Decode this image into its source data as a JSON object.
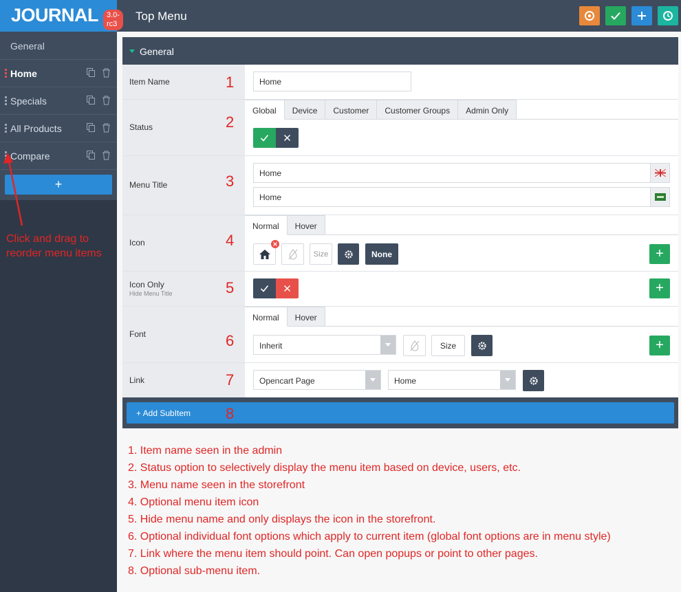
{
  "header": {
    "logo": "JOURNAL",
    "version": "3.0-rc3",
    "title": "Top Menu",
    "colors": {
      "bar": "#3e4c5e",
      "logo_bg": "#2b8bd6",
      "orange": "#e8883a",
      "green": "#27a860",
      "blue": "#2b8bd6",
      "teal": "#1bb5a0"
    }
  },
  "sidebar": {
    "general": "General",
    "items": [
      {
        "label": "Home"
      },
      {
        "label": "Specials"
      },
      {
        "label": "All Products"
      },
      {
        "label": "Compare"
      }
    ],
    "add": "+"
  },
  "side_note": "Click and drag to reorder menu items",
  "panel": {
    "title": "General",
    "rows": {
      "item_name": {
        "label": "Item Name",
        "value": "Home",
        "num": "1"
      },
      "status": {
        "label": "Status",
        "num": "2",
        "tabs": [
          "Global",
          "Device",
          "Customer",
          "Customer Groups",
          "Admin Only"
        ]
      },
      "menu_title": {
        "label": "Menu Title",
        "num": "3",
        "values": [
          "Home",
          "Home"
        ]
      },
      "icon": {
        "label": "Icon",
        "num": "4",
        "tabs": [
          "Normal",
          "Hover"
        ],
        "size_placeholder": "Size",
        "none": "None"
      },
      "icon_only": {
        "label": "Icon Only",
        "sub": "Hide Menu Title",
        "num": "5"
      },
      "font": {
        "label": "Font",
        "num": "6",
        "tabs": [
          "Normal",
          "Hover"
        ],
        "family": "Inherit",
        "size": "Size"
      },
      "link": {
        "label": "Link",
        "num": "7",
        "type": "Opencart Page",
        "page": "Home"
      }
    },
    "add_subitem": "+ Add SubItem",
    "add_num": "8"
  },
  "notes": [
    "1. Item name seen in the admin",
    "2. Status option to selectively display the menu item based on device, users, etc.",
    "3. Menu name seen in the storefront",
    "4. Optional menu item icon",
    "5. Hide menu name and only displays the icon in the storefront.",
    "6. Optional individual font options which apply to current item (global font options are in menu style)",
    "7. Link where the menu item should point. Can open popups or point to other pages.",
    "8. Optional sub-menu item."
  ]
}
